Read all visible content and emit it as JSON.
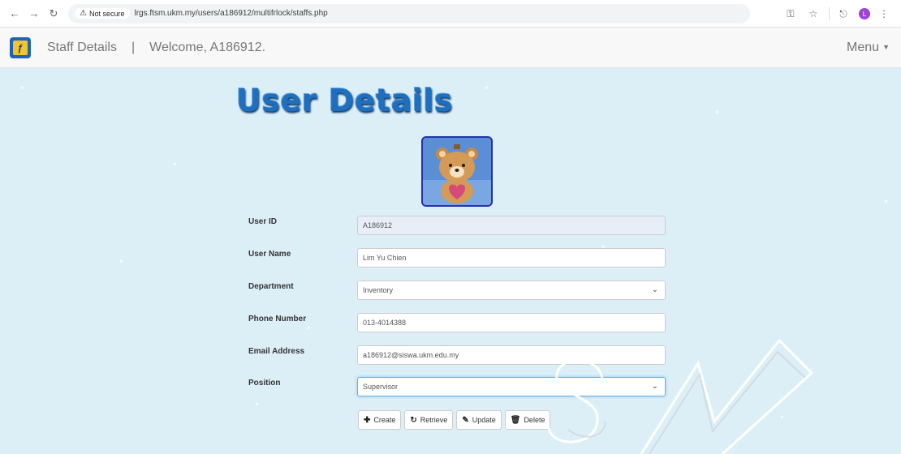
{
  "browser": {
    "back_icon": "arrow-left-icon",
    "forward_icon": "arrow-right-icon",
    "reload_icon": "reload-icon",
    "security_label": "Not secure",
    "url": "lrgs.ftsm.ukm.my/users/a186912/multifrlock/staffs.php",
    "profile_initial": "L"
  },
  "navbar": {
    "title": "Staff Details",
    "separator": "|",
    "welcome": "Welcome, A186912.",
    "menu_label": "Menu"
  },
  "page": {
    "heading": "User Details"
  },
  "form": {
    "user_id": {
      "label": "User ID",
      "value": "A186912"
    },
    "user_name": {
      "label": "User Name",
      "value": "Lim Yu Chien"
    },
    "department": {
      "label": "Department",
      "value": "Inventory"
    },
    "phone": {
      "label": "Phone Number",
      "value": "013-4014388"
    },
    "email": {
      "label": "Email Address",
      "value": "a186912@siswa.ukm.edu.my"
    },
    "position": {
      "label": "Position",
      "value": "Supervisor"
    }
  },
  "buttons": {
    "create": "Create",
    "retrieve": "Retrieve",
    "update": "Update",
    "delete": "Delete"
  },
  "watermark": {
    "text": "FTSM"
  },
  "colors": {
    "background": "#dceff7",
    "heading": "#1f6fbf",
    "avatar_border": "#2233aa"
  }
}
